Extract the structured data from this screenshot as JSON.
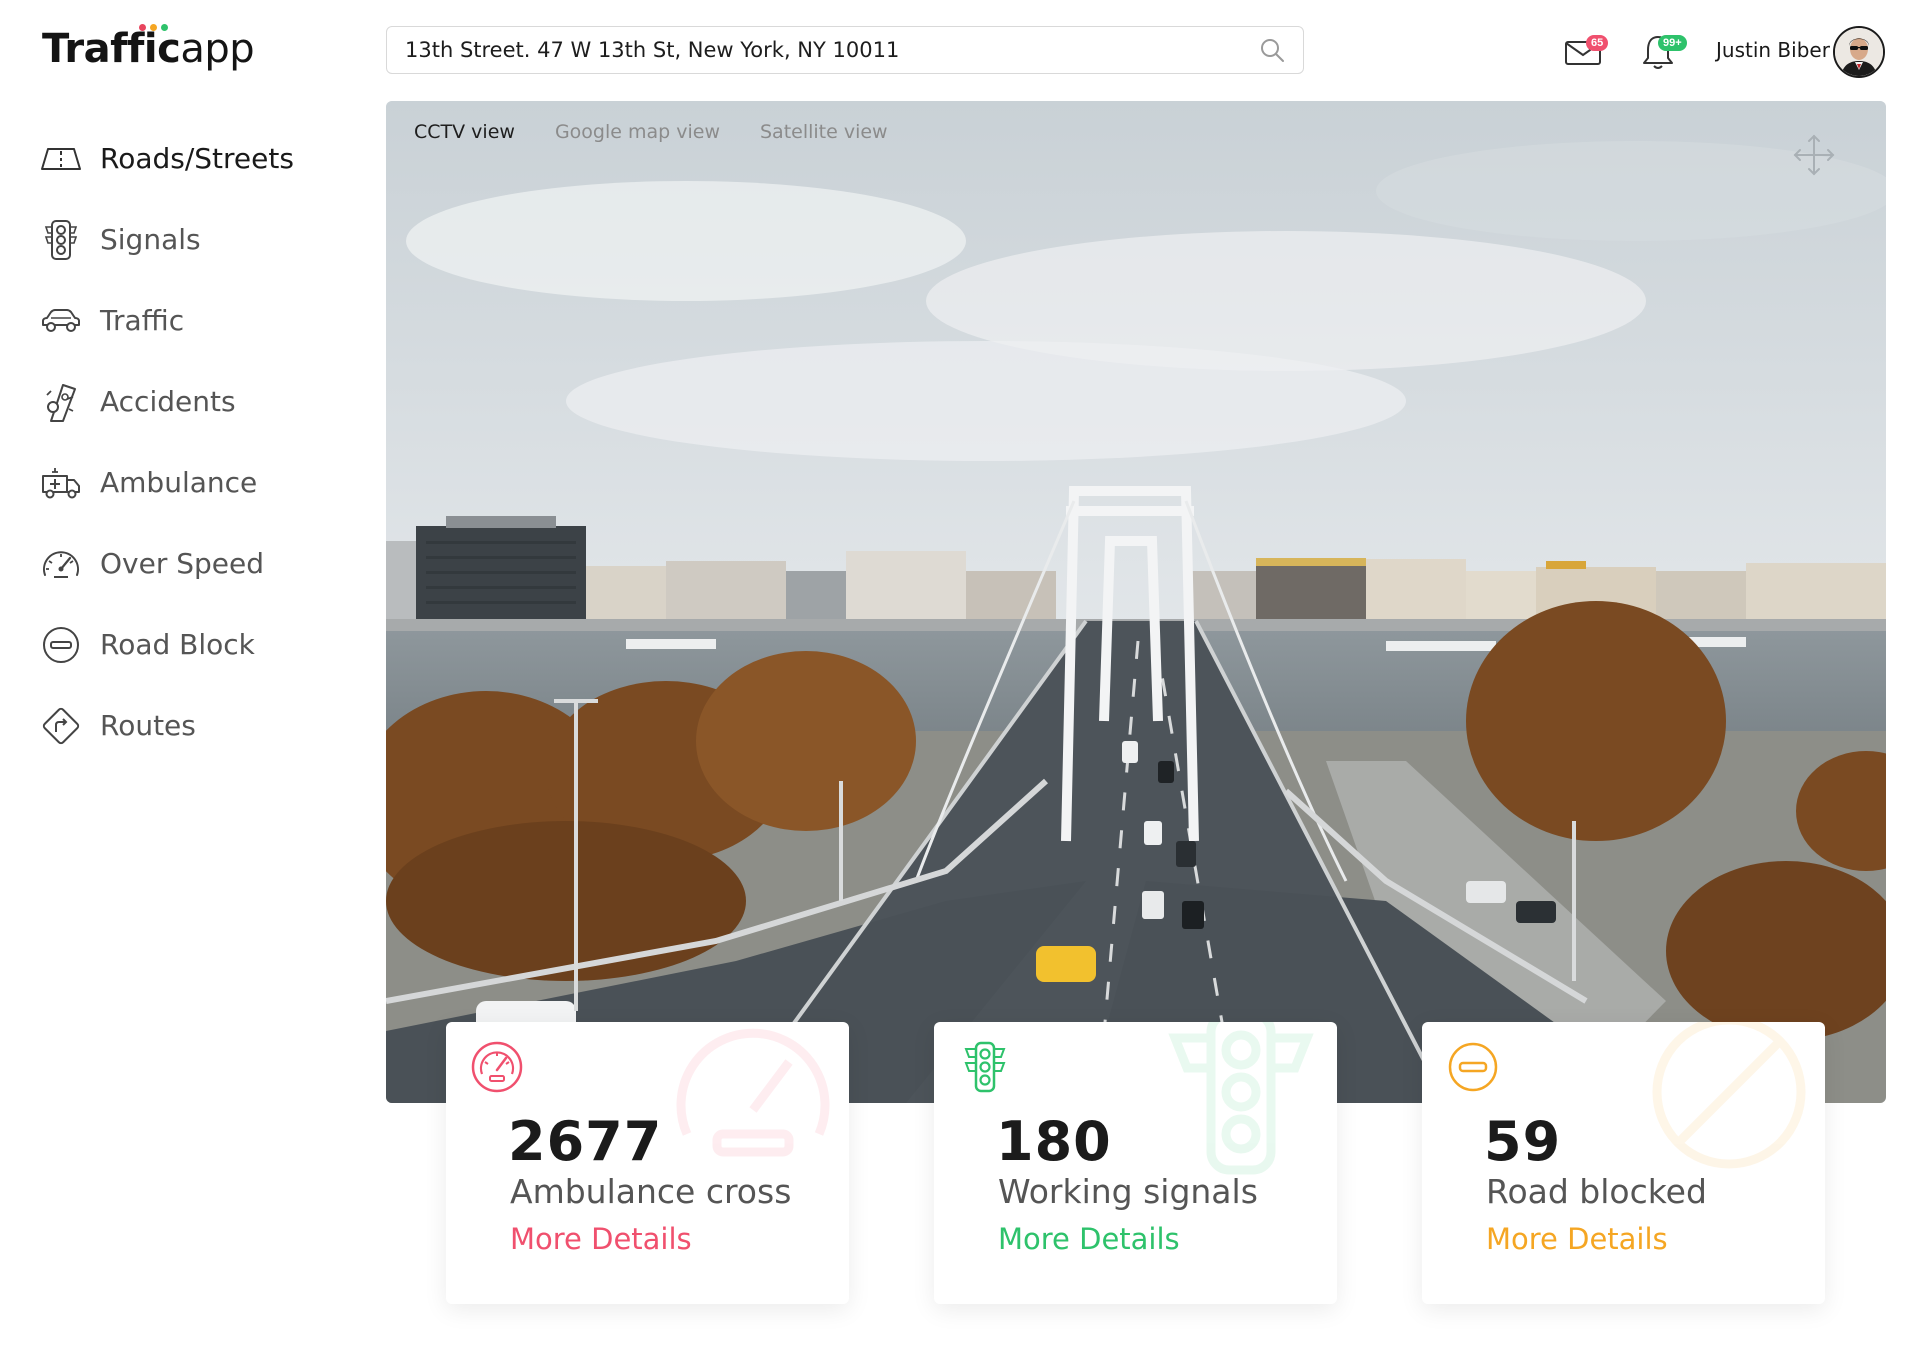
{
  "app": {
    "logo_main": "Traffic",
    "logo_suffix": "app",
    "logo_dot_colors": [
      "#e8455e",
      "#f5a623",
      "#2ec26b"
    ]
  },
  "search": {
    "value": "13th Street. 47 W 13th St, New York, NY 10011",
    "icon": "search-icon"
  },
  "header": {
    "mail_badge": "65",
    "mail_badge_color": "#f0506e",
    "notif_badge": "99+",
    "notif_badge_color": "#2ec26b",
    "user_name": "Justin Biber"
  },
  "sidebar": {
    "items": [
      {
        "label": "Roads/Streets",
        "icon": "road-icon",
        "active": true
      },
      {
        "label": "Signals",
        "icon": "traffic-light-icon"
      },
      {
        "label": "Traffic",
        "icon": "car-icon"
      },
      {
        "label": "Accidents",
        "icon": "accident-icon"
      },
      {
        "label": "Ambulance",
        "icon": "ambulance-icon"
      },
      {
        "label": "Over Speed",
        "icon": "speedometer-icon"
      },
      {
        "label": "Road Block",
        "icon": "road-block-icon"
      },
      {
        "label": "Routes",
        "icon": "route-sign-icon"
      }
    ]
  },
  "view": {
    "tabs": [
      {
        "label": "CCTV view",
        "active": true
      },
      {
        "label": "Google map view"
      },
      {
        "label": "Satellite view"
      }
    ]
  },
  "stats": [
    {
      "value": "2677",
      "label": "Ambulance cross",
      "link": "More Details",
      "color": "#f0506e",
      "icon": "speedometer-icon"
    },
    {
      "value": "180",
      "label": "Working signals",
      "link": "More Details",
      "color": "#2ec26b",
      "icon": "traffic-light-icon"
    },
    {
      "value": "59",
      "label": "Road blocked",
      "link": "More Details",
      "color": "#f5a623",
      "icon": "road-block-icon"
    }
  ]
}
